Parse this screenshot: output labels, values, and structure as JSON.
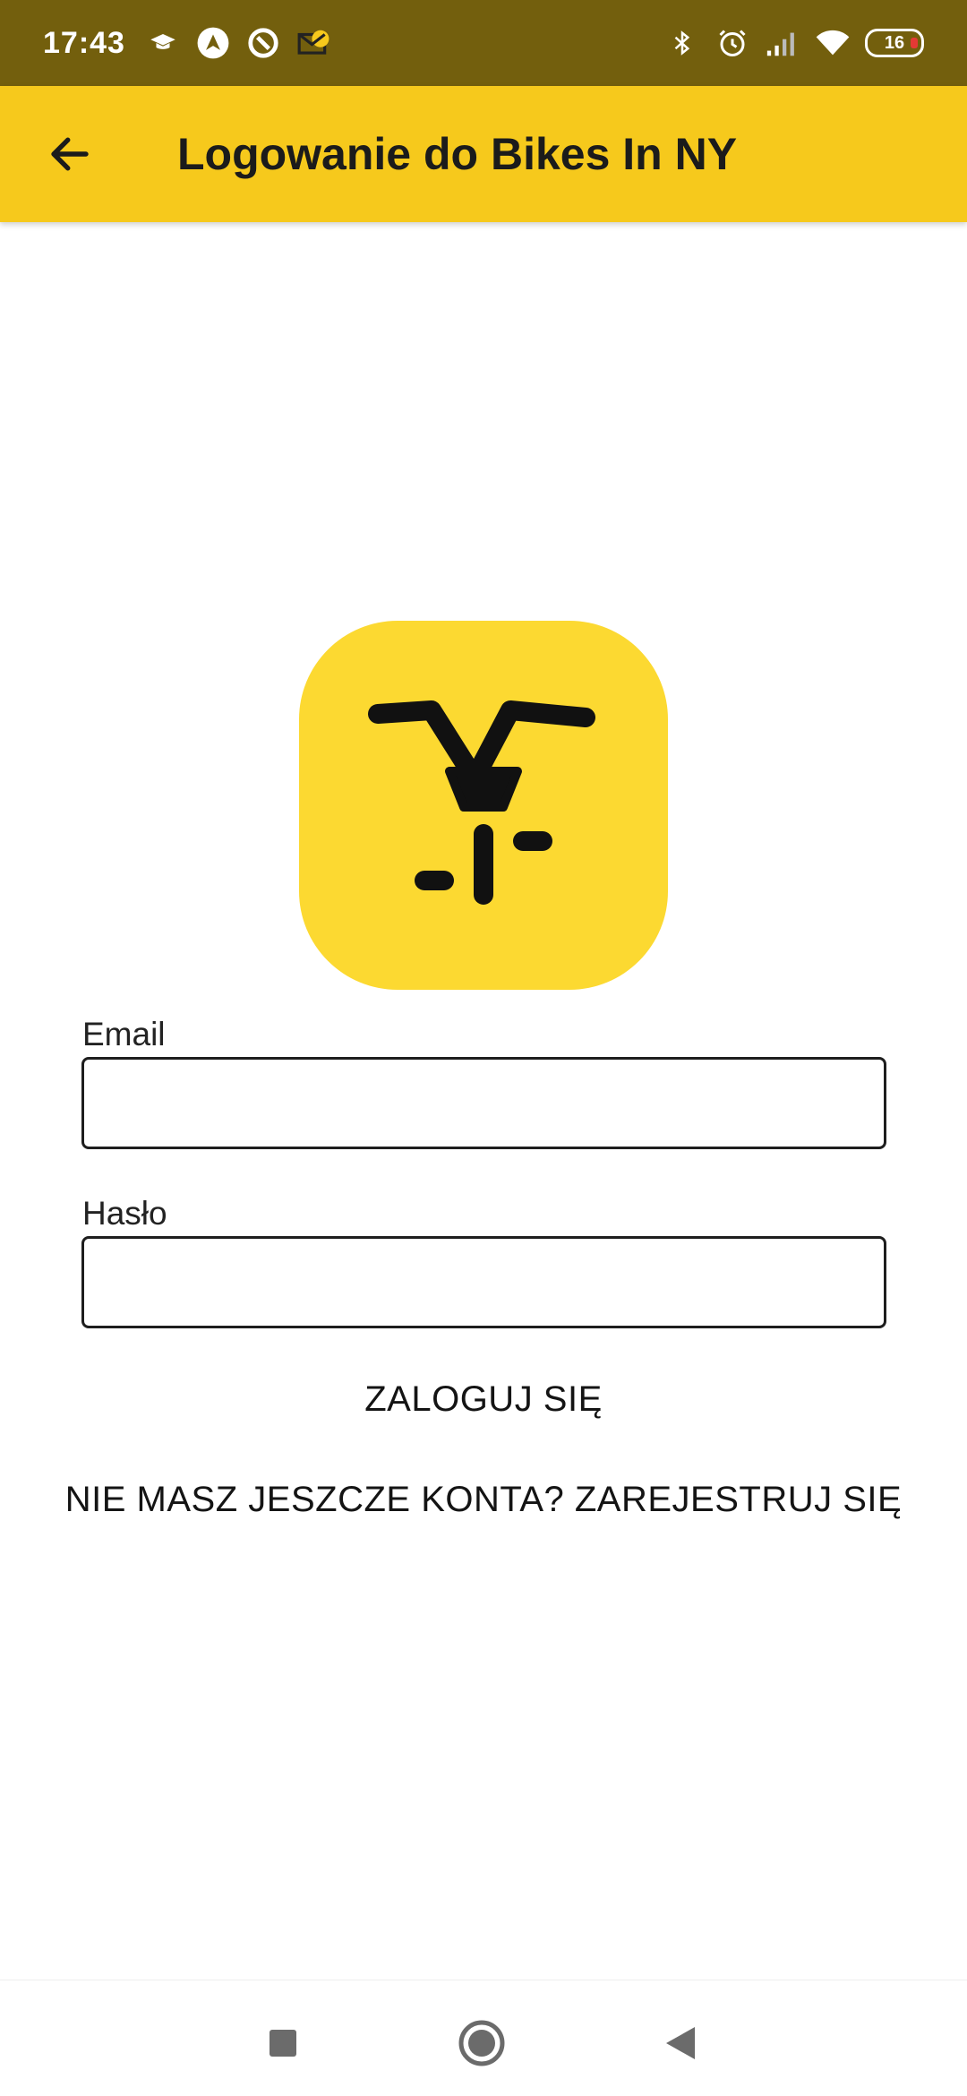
{
  "status_bar": {
    "time": "17:43",
    "battery": "16",
    "left_icons": [
      "graduation-cap-icon",
      "nav-arrow-icon",
      "sync-icon",
      "mail-icon"
    ],
    "right_icons": [
      "bluetooth-icon",
      "alarm-icon",
      "signal-icon",
      "wifi-icon",
      "battery-icon"
    ]
  },
  "app_bar": {
    "title": "Logowanie do Bikes In NY",
    "back_icon": "arrow-left-icon",
    "color": "#f6c91c"
  },
  "logo": {
    "icon": "bike-handlebar-icon",
    "color": "#fcd931"
  },
  "form": {
    "email_label": "Email",
    "email_value": "",
    "password_label": "Hasło",
    "password_value": ""
  },
  "actions": {
    "login_label": "ZALOGUJ SIĘ",
    "register_label": "NIE MASZ JESZCZE KONTA? ZAREJESTRUJ SIĘ"
  },
  "nav_bar": {
    "icons": [
      "recents-square-icon",
      "home-circle-icon",
      "back-triangle-icon"
    ]
  }
}
